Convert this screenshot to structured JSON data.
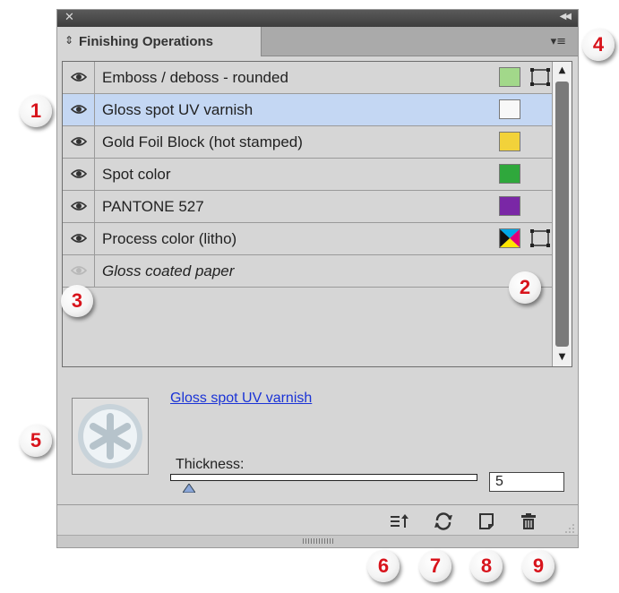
{
  "panel": {
    "tab_title": "Finishing Operations",
    "title_arrows_icon": "up-down-arrows-icon",
    "close_icon": "close-icon",
    "collapse_icon": "double-left-arrow-icon",
    "menu_icon": "panel-menu-icon"
  },
  "rows": [
    {
      "name": "Emboss / deboss - rounded",
      "italic": false,
      "eye_visible": true,
      "selected": false,
      "swatch": "#a2d88a",
      "outline": true
    },
    {
      "name": "Gloss spot UV varnish",
      "italic": false,
      "eye_visible": true,
      "selected": true,
      "swatch": "#f8f8f8",
      "outline": false
    },
    {
      "name": "Gold Foil Block (hot stamped)",
      "italic": false,
      "eye_visible": true,
      "selected": false,
      "swatch": "#f2d23a",
      "outline": false
    },
    {
      "name": "Spot color",
      "italic": false,
      "eye_visible": true,
      "selected": false,
      "swatch": "#2fa83c",
      "outline": false
    },
    {
      "name": "PANTONE 527",
      "italic": false,
      "eye_visible": true,
      "selected": false,
      "swatch": "#7a27a6",
      "outline": false
    },
    {
      "name": "Process color (litho)",
      "italic": false,
      "eye_visible": true,
      "selected": false,
      "swatch": "cmyk",
      "outline": true
    },
    {
      "name": "Gloss coated paper",
      "italic": true,
      "eye_visible": false,
      "selected": false,
      "swatch": null,
      "outline": false
    }
  ],
  "details": {
    "selected_link": "Gloss spot UV varnish",
    "thickness_label": "Thickness:",
    "thickness_value": "5",
    "thickness_slider_fraction": 0.06
  },
  "footer": {
    "buttons": [
      {
        "icon": "sort-up-icon"
      },
      {
        "icon": "refresh-icon"
      },
      {
        "icon": "new-item-icon"
      },
      {
        "icon": "trash-icon"
      }
    ]
  },
  "callouts": [
    "1",
    "2",
    "3",
    "4",
    "5",
    "6",
    "7",
    "8",
    "9"
  ]
}
